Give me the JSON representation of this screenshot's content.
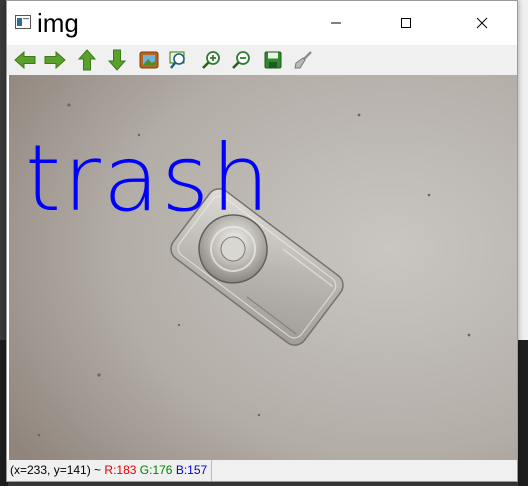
{
  "window": {
    "title": "img"
  },
  "titlebar_controls": {
    "minimize_icon": "minimize-icon",
    "maximize_icon": "maximize-icon",
    "close_icon": "close-icon"
  },
  "toolbar": {
    "buttons": [
      {
        "icon": "arrow-left-icon"
      },
      {
        "icon": "arrow-right-icon"
      },
      {
        "icon": "arrow-up-icon"
      },
      {
        "icon": "arrow-down-icon"
      },
      {
        "icon": "image-icon"
      },
      {
        "icon": "zoom-fit-icon"
      },
      {
        "icon": "zoom-in-icon"
      },
      {
        "icon": "zoom-out-icon"
      },
      {
        "icon": "save-icon"
      },
      {
        "icon": "brush-icon"
      }
    ]
  },
  "canvas": {
    "overlay_label": "trash",
    "overlay_color": "#0000ff",
    "background_color": "#a69f99"
  },
  "status": {
    "coords": "(x=233, y=141) ~",
    "r_label": "R:183",
    "g_label": "G:176",
    "b_label": "B:157",
    "r_color": "#e00000",
    "g_color": "#008000",
    "b_color": "#0000e0"
  }
}
